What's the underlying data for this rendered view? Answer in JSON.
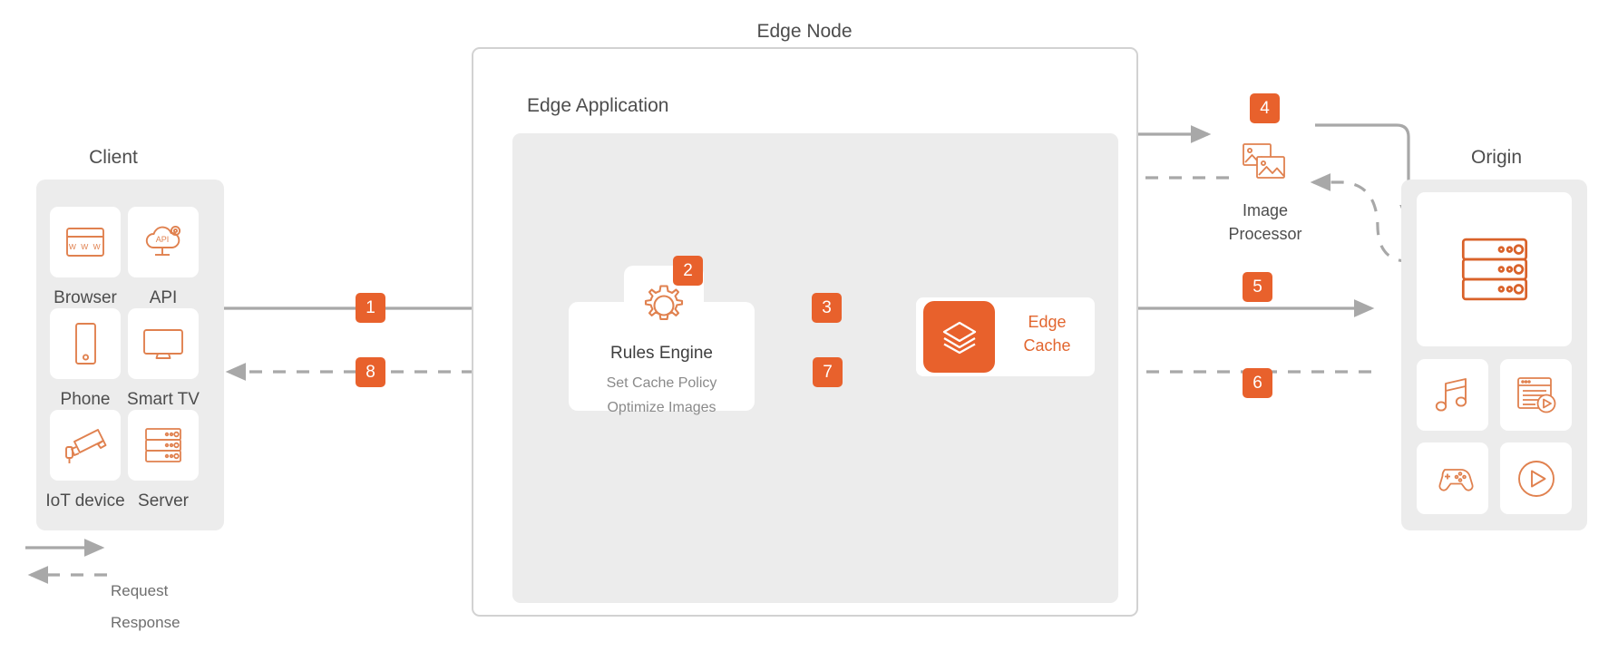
{
  "diagram": {
    "title": "Edge Node",
    "groups": {
      "client": {
        "title": "Client",
        "items": [
          {
            "label": "Browser",
            "icon": "browser-www-icon"
          },
          {
            "label": "API",
            "icon": "api-cloud-icon"
          },
          {
            "label": "Phone",
            "icon": "phone-icon"
          },
          {
            "label": "Smart TV",
            "icon": "smart-tv-icon"
          },
          {
            "label": "IoT device",
            "icon": "iot-camera-icon"
          },
          {
            "label": "Server",
            "icon": "server-rack-icon"
          }
        ]
      },
      "edge_node": {
        "title": "Edge Node",
        "edge_application": {
          "title": "Edge Application",
          "rules_engine": {
            "title": "Rules Engine",
            "icon": "gear-icon",
            "lines": [
              "Set Cache Policy",
              "Optimize Images"
            ],
            "badge": "2"
          },
          "edge_cache": {
            "line1": "Edge",
            "line2": "Cache",
            "icon": "layers-stack-icon"
          }
        }
      },
      "image_processor": {
        "line1": "Image",
        "line2": "Processor",
        "icon": "image-processor-icon",
        "badge": "4"
      },
      "origin": {
        "title": "Origin",
        "items": [
          {
            "label": "",
            "icon": "server-rack-icon"
          },
          {
            "label": "",
            "icon": "music-note-icon"
          },
          {
            "label": "",
            "icon": "news-video-icon"
          },
          {
            "label": "",
            "icon": "gamepad-icon"
          },
          {
            "label": "",
            "icon": "play-circle-icon"
          }
        ]
      }
    },
    "flow_badges": [
      {
        "id": "1",
        "label": "1"
      },
      {
        "id": "2",
        "label": "2"
      },
      {
        "id": "3",
        "label": "3"
      },
      {
        "id": "4",
        "label": "4"
      },
      {
        "id": "5",
        "label": "5"
      },
      {
        "id": "6",
        "label": "6"
      },
      {
        "id": "7",
        "label": "7"
      },
      {
        "id": "8",
        "label": "8"
      }
    ],
    "legend": {
      "request": "Request",
      "response": "Response"
    },
    "colors": {
      "accent": "#e8612c",
      "accent_text": "#e2662f",
      "icon_outline": "#e0814f",
      "panel_bg": "#ececec",
      "arrow": "#a8a8a8",
      "text": "#4d4d4d",
      "muted_text": "#8a8a8a",
      "border": "#d2d2d2"
    }
  }
}
